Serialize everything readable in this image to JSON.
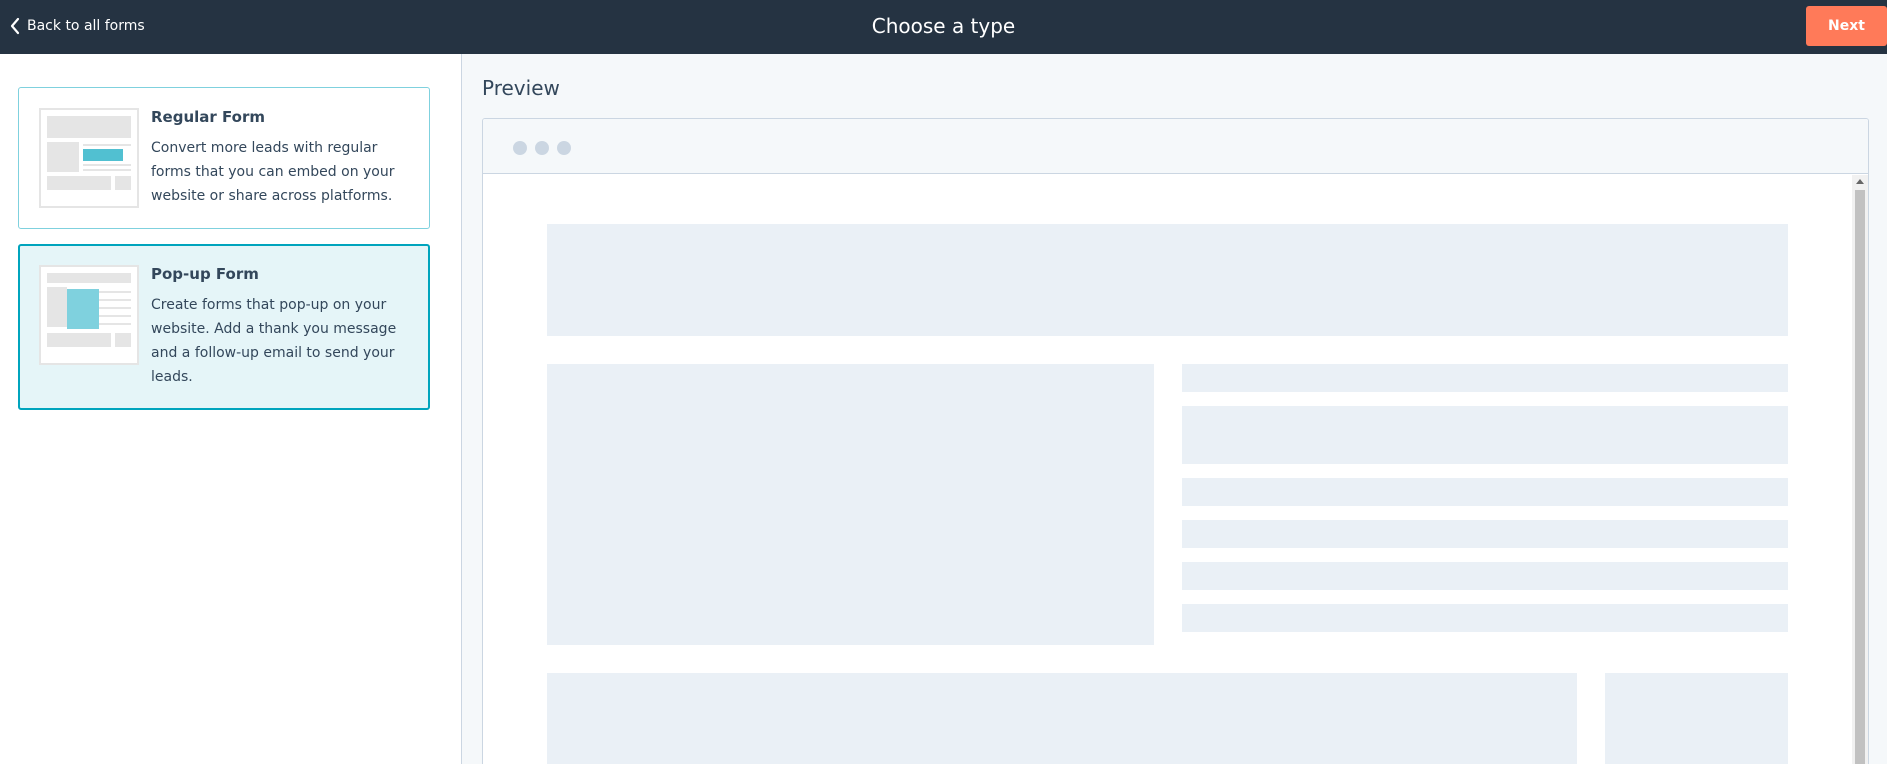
{
  "header": {
    "back_label": "Back to all forms",
    "title": "Choose a type",
    "next_label": "Next"
  },
  "form_types": [
    {
      "title": "Regular Form",
      "description": "Convert more leads with regular forms that you can embed on your website or share across platforms.",
      "selected": false
    },
    {
      "title": "Pop-up Form",
      "description": "Create forms that pop-up on your website. Add a thank you message and a follow-up email to send your leads.",
      "selected": true
    }
  ],
  "preview": {
    "label": "Preview"
  },
  "colors": {
    "header_bg": "#253342",
    "accent_orange": "#ff7a59",
    "selected_border": "#00a4bd",
    "selected_bg": "#e5f5f8",
    "thumb_highlight_regular": "#51c0d1",
    "thumb_highlight_popup": "#7fd1de",
    "placeholder_block": "#eaf0f6"
  }
}
